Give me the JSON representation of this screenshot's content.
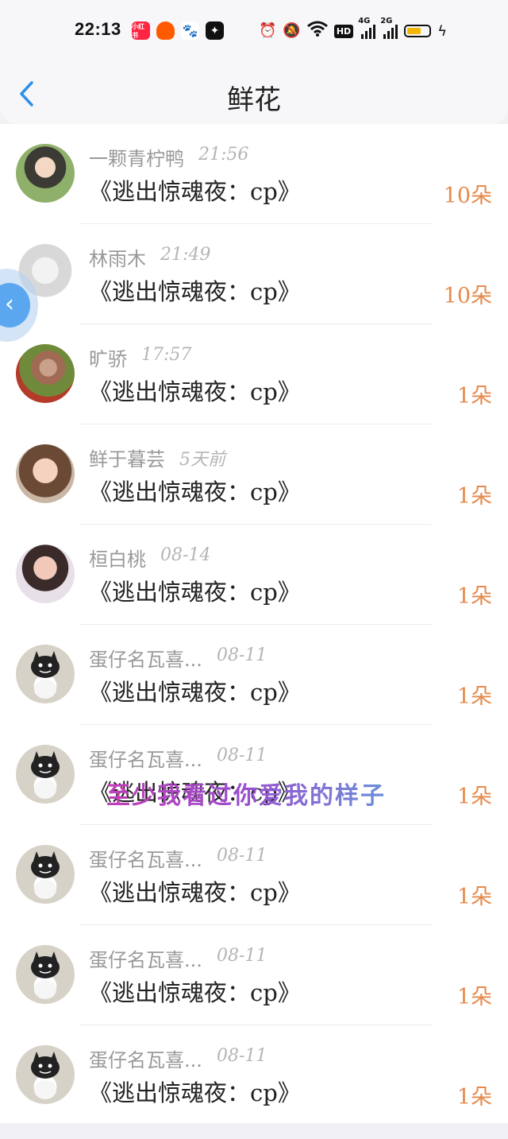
{
  "status_bar": {
    "time": "22:13",
    "app_icons": [
      {
        "name": "xiaohongshu-icon",
        "label": "小红书",
        "color": "#ff2442"
      },
      {
        "name": "taobao-icon",
        "label": "",
        "color": "#ff5a00"
      },
      {
        "name": "baidu-icon",
        "label": "",
        "color": "#2a6de6"
      },
      {
        "name": "app-star-icon",
        "label": "",
        "color": "#111111"
      }
    ],
    "hd_label": "HD",
    "signal_1": "4G",
    "signal_2": "2G",
    "battery_color": "#f2b600"
  },
  "nav": {
    "title": "鲜花",
    "back_icon": "chevron-left-icon",
    "accent": "#2e90e8"
  },
  "overlay": {
    "text": "至少我看过你爱我的样子"
  },
  "rows": [
    {
      "name": "一颗青柠鸭",
      "time": "21:56",
      "book": "《逃出惊魂夜：cp》",
      "flowers": "10朵",
      "avatar": "girl-illustration"
    },
    {
      "name": "林雨木",
      "time": "21:49",
      "book": "《逃出惊魂夜：cp》",
      "flowers": "10朵",
      "avatar": "white-hair-anime"
    },
    {
      "name": "旷骄",
      "time": "17:57",
      "book": "《逃出惊魂夜：cp》",
      "flowers": "1朵",
      "avatar": "girl-in-field"
    },
    {
      "name": "鲜于暮芸",
      "time": "5天前",
      "book": "《逃出惊魂夜：cp》",
      "flowers": "1朵",
      "avatar": "portrait-girl"
    },
    {
      "name": "桓白桃",
      "time": "08-14",
      "book": "《逃出惊魂夜：cp》",
      "flowers": "1朵",
      "avatar": "girl-with-text"
    },
    {
      "name": "蛋仔名瓦喜...",
      "time": "08-11",
      "book": "《逃出惊魂夜：cp》",
      "flowers": "1朵",
      "avatar": "cat-shadow"
    },
    {
      "name": "蛋仔名瓦喜...",
      "time": "08-11",
      "book": "《逃出惊魂夜：cp》",
      "flowers": "1朵",
      "avatar": "cat-shadow"
    },
    {
      "name": "蛋仔名瓦喜...",
      "time": "08-11",
      "book": "《逃出惊魂夜：cp》",
      "flowers": "1朵",
      "avatar": "cat-shadow"
    },
    {
      "name": "蛋仔名瓦喜...",
      "time": "08-11",
      "book": "《逃出惊魂夜：cp》",
      "flowers": "1朵",
      "avatar": "cat-shadow"
    },
    {
      "name": "蛋仔名瓦喜...",
      "time": "08-11",
      "book": "《逃出惊魂夜：cp》",
      "flowers": "1朵",
      "avatar": "cat-shadow"
    }
  ]
}
